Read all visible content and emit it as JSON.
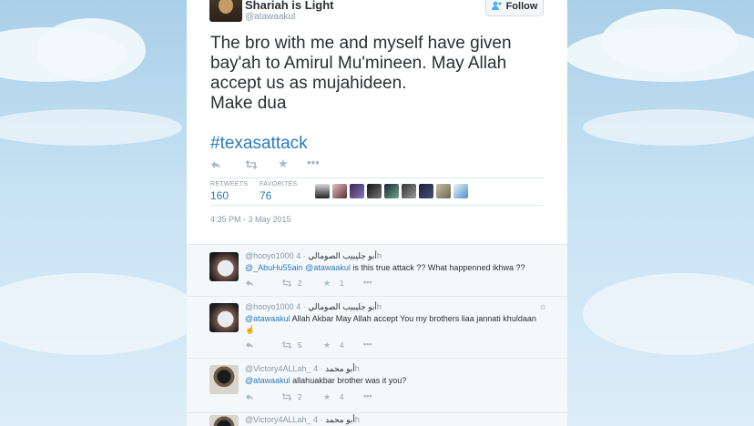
{
  "colors": {
    "link": "#2b7bb9",
    "text": "#292f33",
    "muted": "#8899a6",
    "accent": "#55acee"
  },
  "tweet": {
    "display_name": "Shariah is Light",
    "handle": "@atawaakul",
    "follow_label": "Follow",
    "text": "The bro with me and myself have given\nbay'ah to Amirul Mu'mineen. May Allah\naccept us as mujahideen.\nMake dua",
    "hashtag": "#texasattack",
    "retweets_label": "RETWEETS",
    "retweets": "160",
    "favorites_label": "FAVORITES",
    "favorites": "76",
    "timestamp": "4:35 PM - 3 May 2015",
    "actions": {
      "reply_icon": "reply-icon",
      "retweet_icon": "retweet-icon",
      "favorite_icon": "star-icon",
      "more_icon": "more-icon"
    }
  },
  "replies": [
    {
      "name": "أبو جليبيب الصومالي",
      "handle": "@hooyo1000",
      "time": "· 4h",
      "mentions": "@_AbuHu55ain @atawaakul",
      "text": " is this true attack ?? What happenned ikhwa ??",
      "retweets": "2",
      "favorites": "1"
    },
    {
      "name": "أبو جليبيب الصومالي",
      "handle": "@hooyo1000",
      "time": "· 4h",
      "mentions": "@atawaakul",
      "text": " Allah Akbar May Allah accept You my brothers liaa jannati khuldaan",
      "emoji": "☝",
      "retweets": "5",
      "favorites": "4"
    },
    {
      "name": "أبو محمد",
      "handle": "@Victory4ALLah_",
      "time": "· 4h",
      "mentions": "@atawaakul",
      "text": " allahuakbar brother was it you?",
      "retweets": "2",
      "favorites": "4"
    },
    {
      "name": "أبو محمد",
      "handle": "@Victory4ALLah_",
      "time": "· 4h"
    }
  ]
}
